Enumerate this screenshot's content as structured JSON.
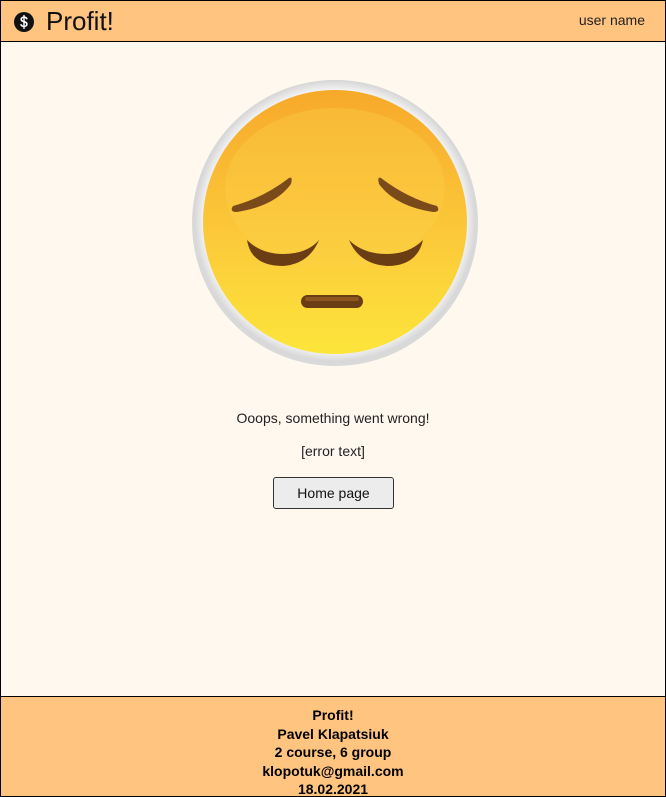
{
  "header": {
    "brand": "Profit!",
    "user_name": "user name",
    "logo_icon": "dollar-coin-icon"
  },
  "main": {
    "illustration": "pensive-face-emoji",
    "message": "Ooops, something went wrong!",
    "error_text": "[error text]",
    "home_button_label": "Home page"
  },
  "footer": {
    "lines": [
      "Profit!",
      "Pavel Klapatsiuk",
      "2 course, 6 group",
      "klopotuk@gmail.com",
      "18.02.2021"
    ]
  },
  "colors": {
    "header_bg": "#ffc47f",
    "page_bg": "#fff8ee",
    "footer_bg": "#ffc47f"
  }
}
